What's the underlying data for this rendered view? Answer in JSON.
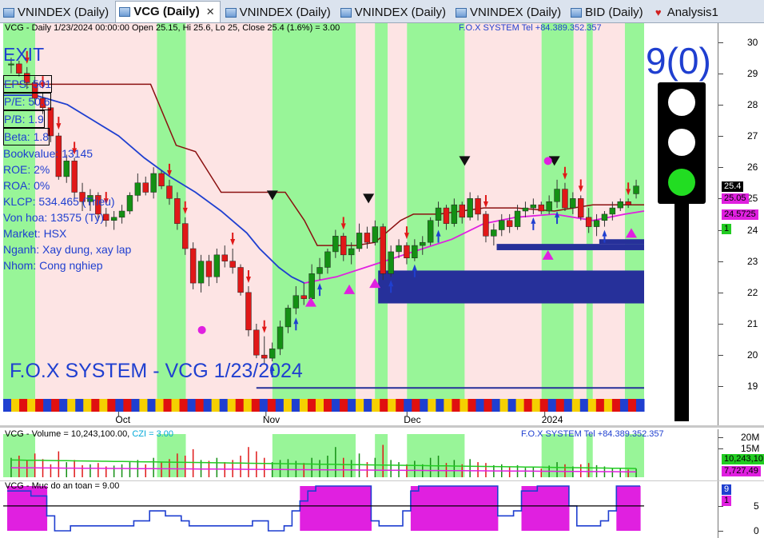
{
  "tabs": [
    {
      "label": "VNINDEX (Daily)",
      "active": false,
      "closable": false,
      "icon": "chart-icon"
    },
    {
      "label": "VCG (Daily)",
      "active": true,
      "closable": true,
      "icon": "chart-icon"
    },
    {
      "label": "VNINDEX (Daily)",
      "active": false,
      "closable": false,
      "icon": "chart-icon"
    },
    {
      "label": "VNINDEX (Daily)",
      "active": false,
      "closable": false,
      "icon": "chart-icon"
    },
    {
      "label": "VNINDEX (Daily)",
      "active": false,
      "closable": false,
      "icon": "chart-icon"
    },
    {
      "label": "BID (Daily)",
      "active": false,
      "closable": false,
      "icon": "chart-icon"
    },
    {
      "label": "Analysis1",
      "active": false,
      "closable": false,
      "icon": "analysis-icon"
    }
  ],
  "price_pane": {
    "title": "VCG - Daily 1/23/2024 00:00:00 Open 25.15, Hi 25.6, Lo 25, Close 25.4 (1.6%)   = 3.00",
    "fox_tel": "F.O.X SYSTEM Tel +84.389.352.357",
    "exit_label": "EXIT",
    "info": [
      {
        "text": "EPS: 501",
        "boxed": true
      },
      {
        "text": "P/E: 50.6",
        "boxed": true
      },
      {
        "text": "P/B: 1.9",
        "boxed": true
      },
      {
        "text": "Beta: 1.8",
        "boxed": true
      },
      {
        "text": "Bookvalue: 13145",
        "boxed": false
      },
      {
        "text": "ROE: 2%",
        "boxed": false
      },
      {
        "text": "ROA: 0%",
        "boxed": false
      },
      {
        "text": "KLCP: 534.465 (Trieu)",
        "boxed": false
      },
      {
        "text": "Von hoa: 13575 (Ty)",
        "boxed": false
      },
      {
        "text": "Market: HSX",
        "boxed": false
      },
      {
        "text": "Nganh: Xay dung, xay lap",
        "boxed": false
      },
      {
        "text": "Nhom: Cong nghiep",
        "boxed": false
      }
    ],
    "watermark": "F.O.X SYSTEM - VCG 1/23/2024",
    "signal_number": "9(0)",
    "traffic_light": {
      "active": "green",
      "colors": {
        "off": "#ffffff",
        "green": "#22dd22"
      }
    },
    "y_ticks": [
      30,
      29,
      28,
      27,
      26,
      25,
      24,
      23,
      22,
      21,
      20,
      19
    ],
    "y_tags": [
      {
        "value": "25.4",
        "bg": "#000000",
        "fg": "#ffffff"
      },
      {
        "value": "25.05",
        "bg": "#e020e0",
        "fg": "#000000"
      },
      {
        "value": "24.5725",
        "bg": "#e020e0",
        "fg": "#000000"
      },
      {
        "value": "1",
        "bg": "#22cc22",
        "fg": "#000000"
      }
    ],
    "x_labels": [
      "Oct",
      "Nov",
      "Dec",
      "2024"
    ]
  },
  "volume_pane": {
    "title_prefix": "VCG - Volume = 10,243,100.00,",
    "title_czi": "CZI = 3.00",
    "fox_tel": "F.O.X SYSTEM Tel +84.389.352.357",
    "y_ticks": [
      "20M",
      "15M"
    ],
    "tags": [
      {
        "value": "10,243,10",
        "bg": "#22cc22",
        "fg": "#000000"
      },
      {
        "value": "7,727,49",
        "bg": "#e020e0",
        "fg": "#000000"
      }
    ]
  },
  "safety_pane": {
    "title": "VCG - Muc do an toan = 9.00",
    "y_ticks": [
      "5",
      "0"
    ],
    "tags": [
      {
        "value": "9",
        "bg": "#1f3fd0",
        "fg": "#ffffff"
      },
      {
        "value": "1",
        "bg": "#e020e0",
        "fg": "#000000"
      }
    ]
  },
  "chart_data": {
    "type": "candlestick",
    "symbol": "VCG",
    "ylim": [
      18.6,
      30.6
    ],
    "last_bar": {
      "date": "1/23/2024",
      "open": 25.15,
      "high": 25.6,
      "low": 25,
      "close": 25.4,
      "change_pct": 1.6
    },
    "candles": [
      [
        29.3,
        29.5,
        29.0,
        29.3
      ],
      [
        29.3,
        29.4,
        28.9,
        29.0
      ],
      [
        29.0,
        29.2,
        28.5,
        28.7
      ],
      [
        28.7,
        28.9,
        28.0,
        28.2
      ],
      [
        28.2,
        28.4,
        27.7,
        27.9
      ],
      [
        27.9,
        28.0,
        26.8,
        27.0
      ],
      [
        27.0,
        27.1,
        25.6,
        25.7
      ],
      [
        25.7,
        26.4,
        25.5,
        26.2
      ],
      [
        26.2,
        26.3,
        25.0,
        25.2
      ],
      [
        25.2,
        25.5,
        24.6,
        24.9
      ],
      [
        24.9,
        25.3,
        24.6,
        25.1
      ],
      [
        25.1,
        25.2,
        24.3,
        24.5
      ],
      [
        24.5,
        24.7,
        24.1,
        24.3
      ],
      [
        24.3,
        24.6,
        24.0,
        24.4
      ],
      [
        24.4,
        24.8,
        24.2,
        24.6
      ],
      [
        24.6,
        25.2,
        24.5,
        25.1
      ],
      [
        25.1,
        25.8,
        24.9,
        25.5
      ],
      [
        25.5,
        25.7,
        25.1,
        25.2
      ],
      [
        25.2,
        26.0,
        25.0,
        25.8
      ],
      [
        25.8,
        25.9,
        25.3,
        25.4
      ],
      [
        25.4,
        25.6,
        24.8,
        25.0
      ],
      [
        25.0,
        25.2,
        24.0,
        24.2
      ],
      [
        24.2,
        24.4,
        23.2,
        23.4
      ],
      [
        23.4,
        23.6,
        22.1,
        22.3
      ],
      [
        22.3,
        23.2,
        22.0,
        23.0
      ],
      [
        23.0,
        23.2,
        22.2,
        22.5
      ],
      [
        22.5,
        23.4,
        22.3,
        23.2
      ],
      [
        23.2,
        23.5,
        22.8,
        23.0
      ],
      [
        23.0,
        23.4,
        22.6,
        22.8
      ],
      [
        22.8,
        22.9,
        21.9,
        22.0
      ],
      [
        22.0,
        22.2,
        20.6,
        20.8
      ],
      [
        20.8,
        21.0,
        19.9,
        20.0
      ],
      [
        20.0,
        20.6,
        19.7,
        19.9
      ],
      [
        19.9,
        20.4,
        19.8,
        20.2
      ],
      [
        20.2,
        21.1,
        20.0,
        20.9
      ],
      [
        20.9,
        21.6,
        20.7,
        21.5
      ],
      [
        21.5,
        22.2,
        21.3,
        21.9
      ],
      [
        21.9,
        22.3,
        21.6,
        21.8
      ],
      [
        21.8,
        22.9,
        21.7,
        22.6
      ],
      [
        22.6,
        23.1,
        22.4,
        22.8
      ],
      [
        22.8,
        23.4,
        22.6,
        23.3
      ],
      [
        23.3,
        24.0,
        23.1,
        23.8
      ],
      [
        23.8,
        23.9,
        23.0,
        23.2
      ],
      [
        23.2,
        23.6,
        22.9,
        23.4
      ],
      [
        23.4,
        24.2,
        23.3,
        23.9
      ],
      [
        23.9,
        24.1,
        23.4,
        23.6
      ],
      [
        23.6,
        24.3,
        23.5,
        24.1
      ],
      [
        24.1,
        24.2,
        22.4,
        22.6
      ],
      [
        22.6,
        23.5,
        22.5,
        23.3
      ],
      [
        23.3,
        23.7,
        23.1,
        23.5
      ],
      [
        23.5,
        23.6,
        22.9,
        23.1
      ],
      [
        23.1,
        23.7,
        23.0,
        23.5
      ],
      [
        23.5,
        23.8,
        23.2,
        23.6
      ],
      [
        23.6,
        24.4,
        23.5,
        24.3
      ],
      [
        24.3,
        24.9,
        24.1,
        24.7
      ],
      [
        24.7,
        24.8,
        24.0,
        24.2
      ],
      [
        24.2,
        25.0,
        24.1,
        24.8
      ],
      [
        24.8,
        24.9,
        24.2,
        24.4
      ],
      [
        24.4,
        25.2,
        24.3,
        25.0
      ],
      [
        25.0,
        25.1,
        24.3,
        24.5
      ],
      [
        24.5,
        24.6,
        23.6,
        23.8
      ],
      [
        23.8,
        24.2,
        23.5,
        24.0
      ],
      [
        24.0,
        24.5,
        23.8,
        24.3
      ],
      [
        24.3,
        24.5,
        23.9,
        24.1
      ],
      [
        24.1,
        24.8,
        24.0,
        24.6
      ],
      [
        24.6,
        24.9,
        24.4,
        24.7
      ],
      [
        24.7,
        25.0,
        24.5,
        24.8
      ],
      [
        24.8,
        24.9,
        24.5,
        24.6
      ],
      [
        24.6,
        25.1,
        24.5,
        24.9
      ],
      [
        24.9,
        25.6,
        24.7,
        25.3
      ],
      [
        25.3,
        25.5,
        24.6,
        24.7
      ],
      [
        24.7,
        25.2,
        24.5,
        25.0
      ],
      [
        25.0,
        25.1,
        24.3,
        24.4
      ],
      [
        24.4,
        24.7,
        23.9,
        24.1
      ],
      [
        24.1,
        24.5,
        23.8,
        24.3
      ],
      [
        24.3,
        24.6,
        24.1,
        24.5
      ],
      [
        24.5,
        24.9,
        24.3,
        24.7
      ],
      [
        24.7,
        25.0,
        24.6,
        24.9
      ],
      [
        24.9,
        25.0,
        24.7,
        24.8
      ],
      [
        25.15,
        25.6,
        25.0,
        25.4
      ]
    ],
    "zones": [
      {
        "start": 0.0,
        "end": 0.05,
        "color": "green"
      },
      {
        "start": 0.05,
        "end": 0.24,
        "color": "pink"
      },
      {
        "start": 0.24,
        "end": 0.285,
        "color": "green"
      },
      {
        "start": 0.285,
        "end": 0.42,
        "color": "pink"
      },
      {
        "start": 0.42,
        "end": 0.55,
        "color": "green"
      },
      {
        "start": 0.55,
        "end": 0.58,
        "color": "pink"
      },
      {
        "start": 0.58,
        "end": 0.6,
        "color": "green"
      },
      {
        "start": 0.6,
        "end": 0.63,
        "color": "pink"
      },
      {
        "start": 0.63,
        "end": 0.72,
        "color": "green"
      },
      {
        "start": 0.72,
        "end": 0.84,
        "color": "pink"
      },
      {
        "start": 0.84,
        "end": 0.89,
        "color": "green"
      },
      {
        "start": 0.89,
        "end": 0.91,
        "color": "pink"
      },
      {
        "start": 0.91,
        "end": 0.92,
        "color": "green"
      },
      {
        "start": 0.92,
        "end": 0.97,
        "color": "pink"
      },
      {
        "start": 0.97,
        "end": 1.0,
        "color": "green"
      }
    ],
    "stop_line": [
      {
        "t": 0.0,
        "v": 28.65
      },
      {
        "t": 0.23,
        "v": 28.65
      },
      {
        "t": 0.27,
        "v": 26.7
      },
      {
        "t": 0.3,
        "v": 26.5
      },
      {
        "t": 0.34,
        "v": 25.2
      },
      {
        "t": 0.44,
        "v": 25.2
      },
      {
        "t": 0.47,
        "v": 24.3
      },
      {
        "t": 0.49,
        "v": 23.5
      },
      {
        "t": 0.55,
        "v": 23.5
      },
      {
        "t": 0.58,
        "v": 23.6
      },
      {
        "t": 0.62,
        "v": 24.3
      },
      {
        "t": 0.64,
        "v": 24.5
      },
      {
        "t": 0.68,
        "v": 24.5
      },
      {
        "t": 0.75,
        "v": 24.7
      },
      {
        "t": 0.8,
        "v": 24.7
      },
      {
        "t": 0.86,
        "v": 24.6
      },
      {
        "t": 0.92,
        "v": 24.8
      },
      {
        "t": 1.0,
        "v": 24.8
      }
    ],
    "blue_line": [
      {
        "t": 0.0,
        "v": 28.3
      },
      {
        "t": 0.05,
        "v": 28.3
      },
      {
        "t": 0.1,
        "v": 28.0
      },
      {
        "t": 0.14,
        "v": 27.5
      },
      {
        "t": 0.18,
        "v": 27.0
      },
      {
        "t": 0.22,
        "v": 26.3
      },
      {
        "t": 0.26,
        "v": 25.7
      },
      {
        "t": 0.3,
        "v": 25.2
      },
      {
        "t": 0.34,
        "v": 24.6
      },
      {
        "t": 0.38,
        "v": 23.9
      },
      {
        "t": 0.4,
        "v": 23.4
      },
      {
        "t": 0.43,
        "v": 22.8
      },
      {
        "t": 0.45,
        "v": 22.5
      },
      {
        "t": 0.47,
        "v": 22.3
      }
    ],
    "magenta_line": [
      {
        "t": 0.47,
        "v": 22.3
      },
      {
        "t": 0.52,
        "v": 22.5
      },
      {
        "t": 0.58,
        "v": 22.9
      },
      {
        "t": 0.64,
        "v": 23.3
      },
      {
        "t": 0.7,
        "v": 23.7
      },
      {
        "t": 0.75,
        "v": 24.2
      },
      {
        "t": 0.8,
        "v": 24.4
      },
      {
        "t": 0.86,
        "v": 24.5
      },
      {
        "t": 0.92,
        "v": 24.3
      },
      {
        "t": 0.97,
        "v": 24.5
      },
      {
        "t": 1.0,
        "v": 24.6
      }
    ],
    "support_boxes": [
      {
        "x0": 0.585,
        "x1": 1.0,
        "y0": 21.65,
        "y1": 22.7
      },
      {
        "x0": 0.77,
        "x1": 1.0,
        "y0": 23.35,
        "y1": 23.55
      },
      {
        "x0": 0.93,
        "x1": 1.0,
        "y0": 23.55,
        "y1": 23.7
      }
    ],
    "baseline": {
      "x0": 0.395,
      "x1": 1.0,
      "v": 18.95
    },
    "volume": [
      0.45,
      0.5,
      0.38,
      0.55,
      0.42,
      0.3,
      0.6,
      0.35,
      0.4,
      0.28,
      0.3,
      0.33,
      0.25,
      0.27,
      0.3,
      0.35,
      0.4,
      0.3,
      0.45,
      0.35,
      0.42,
      0.55,
      0.5,
      0.65,
      0.4,
      0.38,
      0.45,
      0.35,
      0.4,
      0.5,
      0.7,
      0.6,
      0.45,
      0.35,
      0.4,
      0.42,
      0.38,
      0.33,
      0.45,
      0.4,
      0.5,
      0.7,
      0.45,
      0.4,
      0.55,
      0.35,
      0.45,
      0.75,
      0.4,
      0.35,
      0.3,
      0.38,
      0.3,
      0.45,
      0.5,
      0.33,
      0.4,
      0.3,
      0.42,
      0.35,
      0.33,
      0.28,
      0.3,
      0.25,
      0.28,
      0.22,
      0.25,
      0.2,
      0.27,
      0.35,
      0.3,
      0.25,
      0.3,
      0.33,
      0.28,
      0.25,
      0.22,
      0.2,
      0.18,
      0.2
    ],
    "safety_level": [
      8,
      8,
      8,
      7,
      7,
      3,
      0,
      0,
      1,
      1,
      1,
      1,
      1,
      1,
      1,
      1,
      2,
      2,
      4,
      4,
      3,
      3,
      2,
      1,
      1,
      1,
      1,
      1,
      1,
      1,
      1,
      2,
      2,
      0,
      0,
      1,
      4,
      6,
      8,
      9,
      9,
      9,
      9,
      9,
      9,
      9,
      2,
      1,
      1,
      1,
      4,
      8,
      9,
      9,
      9,
      9,
      9,
      9,
      9,
      9,
      9,
      9,
      3,
      3,
      4,
      8,
      8,
      9,
      9,
      9,
      9,
      5,
      1,
      1,
      1,
      2,
      4,
      9,
      9,
      9
    ]
  }
}
